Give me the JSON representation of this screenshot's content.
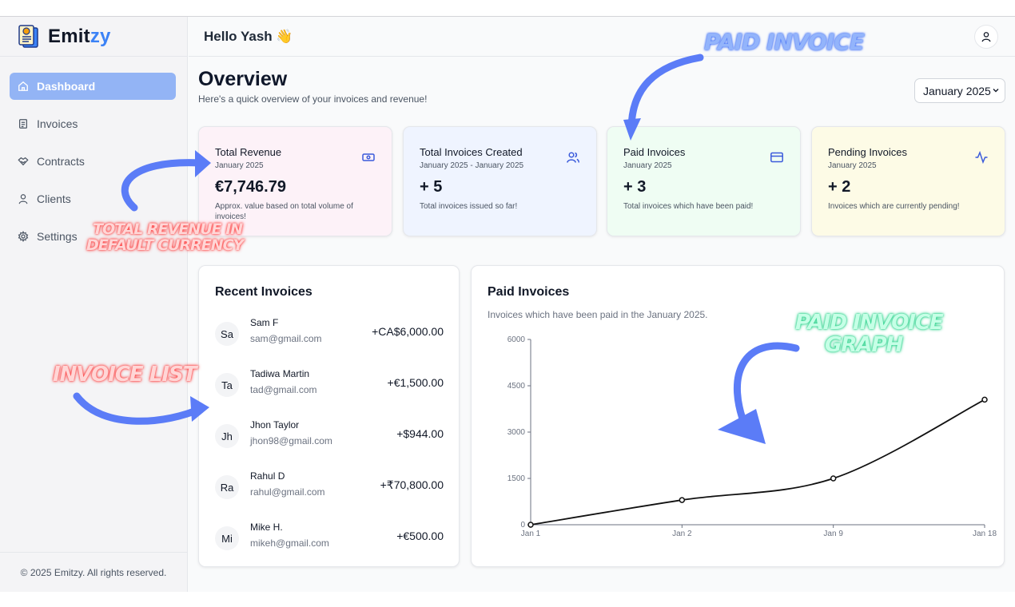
{
  "brand": {
    "name_main": "Emit",
    "name_accent": "zy"
  },
  "header": {
    "greeting": "Hello Yash 👋"
  },
  "sidebar": {
    "items": [
      {
        "label": "Dashboard",
        "icon": "home-icon",
        "active": true
      },
      {
        "label": "Invoices",
        "icon": "document-icon",
        "active": false
      },
      {
        "label": "Contracts",
        "icon": "handshake-icon",
        "active": false
      },
      {
        "label": "Clients",
        "icon": "user-icon",
        "active": false
      },
      {
        "label": "Settings",
        "icon": "gear-icon",
        "active": false
      }
    ],
    "footer": "© 2025 Emitzy. All rights reserved."
  },
  "overview": {
    "title": "Overview",
    "subtitle": "Here's a quick overview of your invoices and revenue!",
    "month_select": "January 2025"
  },
  "cards": [
    {
      "title": "Total Revenue",
      "date": "January 2025",
      "value": "€7,746.79",
      "desc": "Approx. value based on total volume of invoices!",
      "icon": "banknote-icon",
      "bg": "#fdf2f8"
    },
    {
      "title": "Total Invoices Created",
      "date": "January 2025 - January 2025",
      "value": "+ 5",
      "desc": "Total invoices issued so far!",
      "icon": "users-icon",
      "bg": "#eff4ff"
    },
    {
      "title": "Paid Invoices",
      "date": "January 2025",
      "value": "+ 3",
      "desc": "Total invoices which have been paid!",
      "icon": "credit-card-icon",
      "bg": "#effdf3"
    },
    {
      "title": "Pending Invoices",
      "date": "January 2025",
      "value": "+ 2",
      "desc": "Invoices which are currently pending!",
      "icon": "activity-icon",
      "bg": "#fdfbe6"
    }
  ],
  "recent_invoices": {
    "title": "Recent Invoices",
    "items": [
      {
        "initials": "Sa",
        "name": "Sam F",
        "email": "sam@gmail.com",
        "amount": "+CA$6,000.00"
      },
      {
        "initials": "Ta",
        "name": "Tadiwa Martin",
        "email": "tad@gmail.com",
        "amount": "+€1,500.00"
      },
      {
        "initials": "Jh",
        "name": "Jhon Taylor",
        "email": "jhon98@gmail.com",
        "amount": "+$944.00"
      },
      {
        "initials": "Ra",
        "name": "Rahul D",
        "email": "rahul@gmail.com",
        "amount": "+₹70,800.00"
      },
      {
        "initials": "Mi",
        "name": "Mike H.",
        "email": "mikeh@gmail.com",
        "amount": "+€500.00"
      }
    ]
  },
  "paid_chart": {
    "title": "Paid Invoices",
    "subtitle": "Invoices which have been paid in the January 2025."
  },
  "chart_data": {
    "type": "line",
    "x": [
      "Jan 1",
      "Jan 2",
      "Jan 9",
      "Jan 18"
    ],
    "values": [
      0,
      800,
      1500,
      4050
    ],
    "ylim": [
      0,
      6000
    ],
    "yticks": [
      0,
      1500,
      3000,
      4500,
      6000
    ],
    "grid": false,
    "line_color": "#111111"
  },
  "annotations": {
    "paid_invoice": "Paid Invoice",
    "total_revenue_line1": "Total revenue in",
    "total_revenue_line2": "default currency",
    "invoice_list": "Invoice list",
    "graph_line1": "Paid invoice",
    "graph_line2": "graph"
  },
  "colors": {
    "accent": "#3b82f6",
    "active_nav": "#93b4f5",
    "arrow": "#5b7cf7"
  }
}
